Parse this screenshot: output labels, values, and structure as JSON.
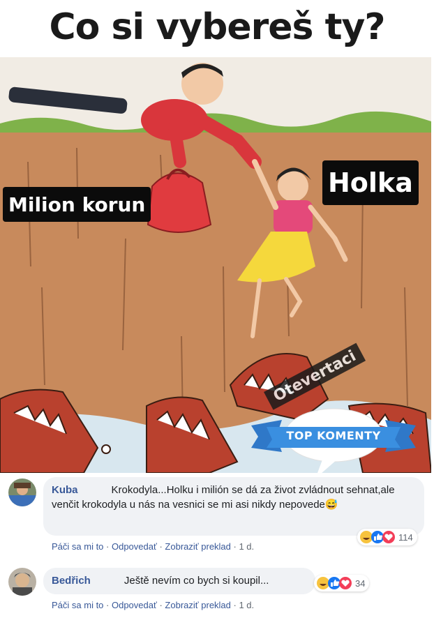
{
  "post": {
    "title": "Co si vybereš ty?",
    "labels": {
      "money": "Milion korun",
      "girl": "Holka"
    },
    "watermark": "Otevertaci",
    "badge": "TOP KOMENTY"
  },
  "comments": [
    {
      "author": "Kuba",
      "text": "Krokodyla...Holku i milión se dá za život zvládnout sehnat,ale venčit krokodyla u nás na vesnici se mi asi nikdy nepovede",
      "emoji": "😅",
      "actions": {
        "like": "Páči sa mi to",
        "reply": "Odpovedať",
        "translate": "Zobraziť preklad",
        "time": "1 d."
      },
      "reaction_count": "114"
    },
    {
      "author": "Bedřich",
      "text": "Ještě nevím co bych si koupil...",
      "emoji": "",
      "actions": {
        "like": "Páči sa mi to",
        "reply": "Odpovedať",
        "translate": "Zobraziť preklad",
        "time": "1 d."
      },
      "reaction_count": "34"
    }
  ]
}
